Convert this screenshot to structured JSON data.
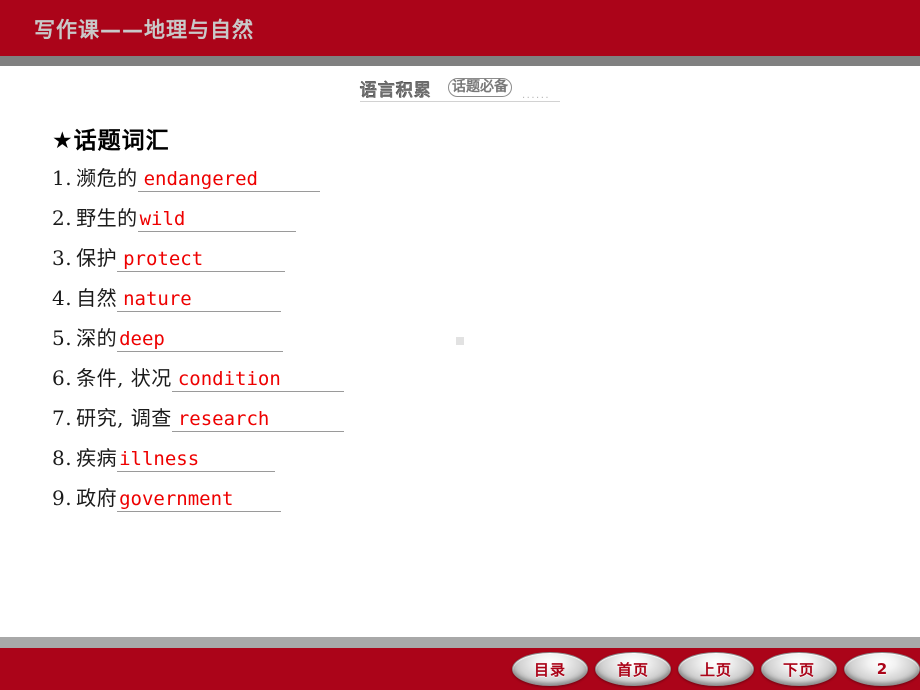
{
  "header": {
    "title": "写作课——地理与自然",
    "bar_color": "#ab0419",
    "title_color": "#c9c9c9"
  },
  "section_banner": {
    "main_text": "语言积累",
    "sub_text": "话题必备",
    "trailing_dots": "......"
  },
  "content": {
    "vocab_heading": "★话题词汇",
    "answer_color": "#ee0000",
    "items": [
      {
        "number": "1.",
        "prompt": "濒危的",
        "answer": "endangered"
      },
      {
        "number": "2.",
        "prompt": "野生的",
        "answer": "wild"
      },
      {
        "number": "3.",
        "prompt": "保护",
        "answer": "protect"
      },
      {
        "number": "4.",
        "prompt": "自然",
        "answer": "nature"
      },
      {
        "number": "5.",
        "prompt": "深的",
        "answer": "deep"
      },
      {
        "number": "6.",
        "prompt": "条件, 状况",
        "answer": "condition"
      },
      {
        "number": "7.",
        "prompt": "研究, 调查",
        "answer": "research"
      },
      {
        "number": "8.",
        "prompt": "疾病",
        "answer": "illness"
      },
      {
        "number": "9.",
        "prompt": "政府",
        "answer": "government"
      }
    ]
  },
  "footer": {
    "bar_color": "#ab0419",
    "buttons": [
      {
        "label": "目录",
        "name": "contents"
      },
      {
        "label": "首页",
        "name": "first-page"
      },
      {
        "label": "上页",
        "name": "previous-page"
      },
      {
        "label": "下页",
        "name": "next-page"
      }
    ],
    "page_number": "2"
  }
}
